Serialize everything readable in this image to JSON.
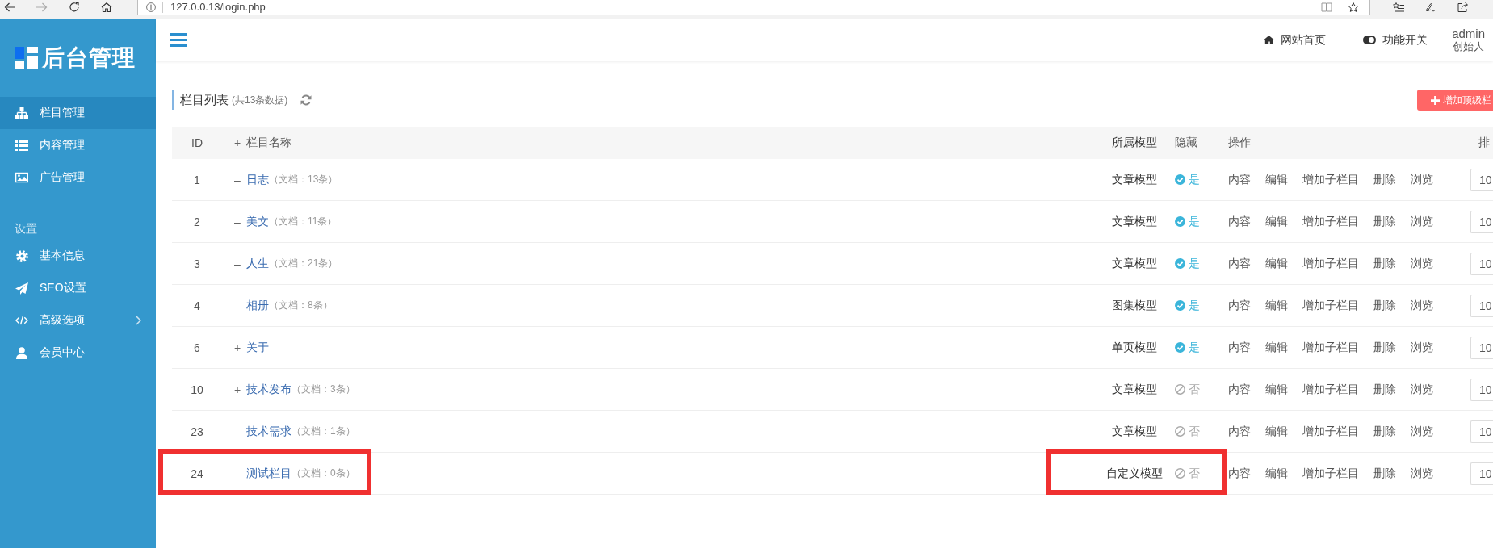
{
  "browser": {
    "url": "127.0.0.13/login.php"
  },
  "sidebar": {
    "logo": "后台管理",
    "groups": [
      {
        "items": [
          {
            "label": "栏目管理",
            "selected": true,
            "expandable": false
          },
          {
            "label": "内容管理",
            "selected": false,
            "expandable": false
          },
          {
            "label": "广告管理",
            "selected": false,
            "expandable": false
          }
        ]
      },
      {
        "heading": "设置",
        "items": [
          {
            "label": "基本信息",
            "selected": false,
            "expandable": false
          },
          {
            "label": "SEO设置",
            "selected": false,
            "expandable": false
          },
          {
            "label": "高级选项",
            "selected": false,
            "expandable": true
          },
          {
            "label": "会员中心",
            "selected": false,
            "expandable": false
          }
        ]
      }
    ]
  },
  "header": {
    "links": [
      {
        "label": "网站首页"
      },
      {
        "label": "功能开关"
      }
    ],
    "user": {
      "name": "admin",
      "role": "创始人"
    }
  },
  "content": {
    "title": "栏目列表",
    "count": "(共13条数据)",
    "add_button": "增加顶级栏",
    "table": {
      "columns": [
        {
          "label": "ID"
        },
        {
          "sign": "+",
          "label": "栏目名称"
        },
        {
          "label": "所属模型"
        },
        {
          "label": "隐藏"
        },
        {
          "label": "操作"
        },
        {
          "label": "排"
        }
      ],
      "rows": [
        {
          "id": "1",
          "sign": "–",
          "name": "日志",
          "docs": "（文档：13条）",
          "model": "文章模型",
          "hidden": true,
          "hidden_label": "是",
          "actions": [
            "内容",
            "编辑",
            "增加子栏目",
            "删除",
            "浏览"
          ],
          "sort": "10",
          "marked": false
        },
        {
          "id": "2",
          "sign": "–",
          "name": "美文",
          "docs": "（文档：11条）",
          "model": "文章模型",
          "hidden": true,
          "hidden_label": "是",
          "actions": [
            "内容",
            "编辑",
            "增加子栏目",
            "删除",
            "浏览"
          ],
          "sort": "10",
          "marked": false
        },
        {
          "id": "3",
          "sign": "–",
          "name": "人生",
          "docs": "（文档：21条）",
          "model": "文章模型",
          "hidden": true,
          "hidden_label": "是",
          "actions": [
            "内容",
            "编辑",
            "增加子栏目",
            "删除",
            "浏览"
          ],
          "sort": "10",
          "marked": false
        },
        {
          "id": "4",
          "sign": "–",
          "name": "相册",
          "docs": "（文档：8条）",
          "model": "图集模型",
          "hidden": true,
          "hidden_label": "是",
          "actions": [
            "内容",
            "编辑",
            "增加子栏目",
            "删除",
            "浏览"
          ],
          "sort": "10",
          "marked": false
        },
        {
          "id": "6",
          "sign": "+",
          "name": "关于",
          "model": "单页模型",
          "hidden": true,
          "hidden_label": "是",
          "actions": [
            "内容",
            "编辑",
            "增加子栏目",
            "删除",
            "浏览"
          ],
          "sort": "10",
          "marked": false
        },
        {
          "id": "10",
          "sign": "+",
          "name": "技术发布",
          "docs": "（文档：3条）",
          "model": "文章模型",
          "hidden": false,
          "hidden_label": "否",
          "actions": [
            "内容",
            "编辑",
            "增加子栏目",
            "删除",
            "浏览"
          ],
          "sort": "10",
          "marked": false
        },
        {
          "id": "23",
          "sign": "–",
          "name": "技术需求",
          "docs": "（文档：1条）",
          "model": "文章模型",
          "hidden": false,
          "hidden_label": "否",
          "actions": [
            "内容",
            "编辑",
            "增加子栏目",
            "删除",
            "浏览"
          ],
          "sort": "10",
          "marked": false
        },
        {
          "id": "24",
          "sign": "–",
          "name": "测试栏目",
          "docs": "（文档：0条）",
          "model": "自定义模型",
          "hidden": false,
          "hidden_label": "否",
          "actions": [
            "内容",
            "编辑",
            "增加子栏目",
            "删除",
            "浏览"
          ],
          "sort": "10",
          "marked": true
        }
      ]
    }
  }
}
